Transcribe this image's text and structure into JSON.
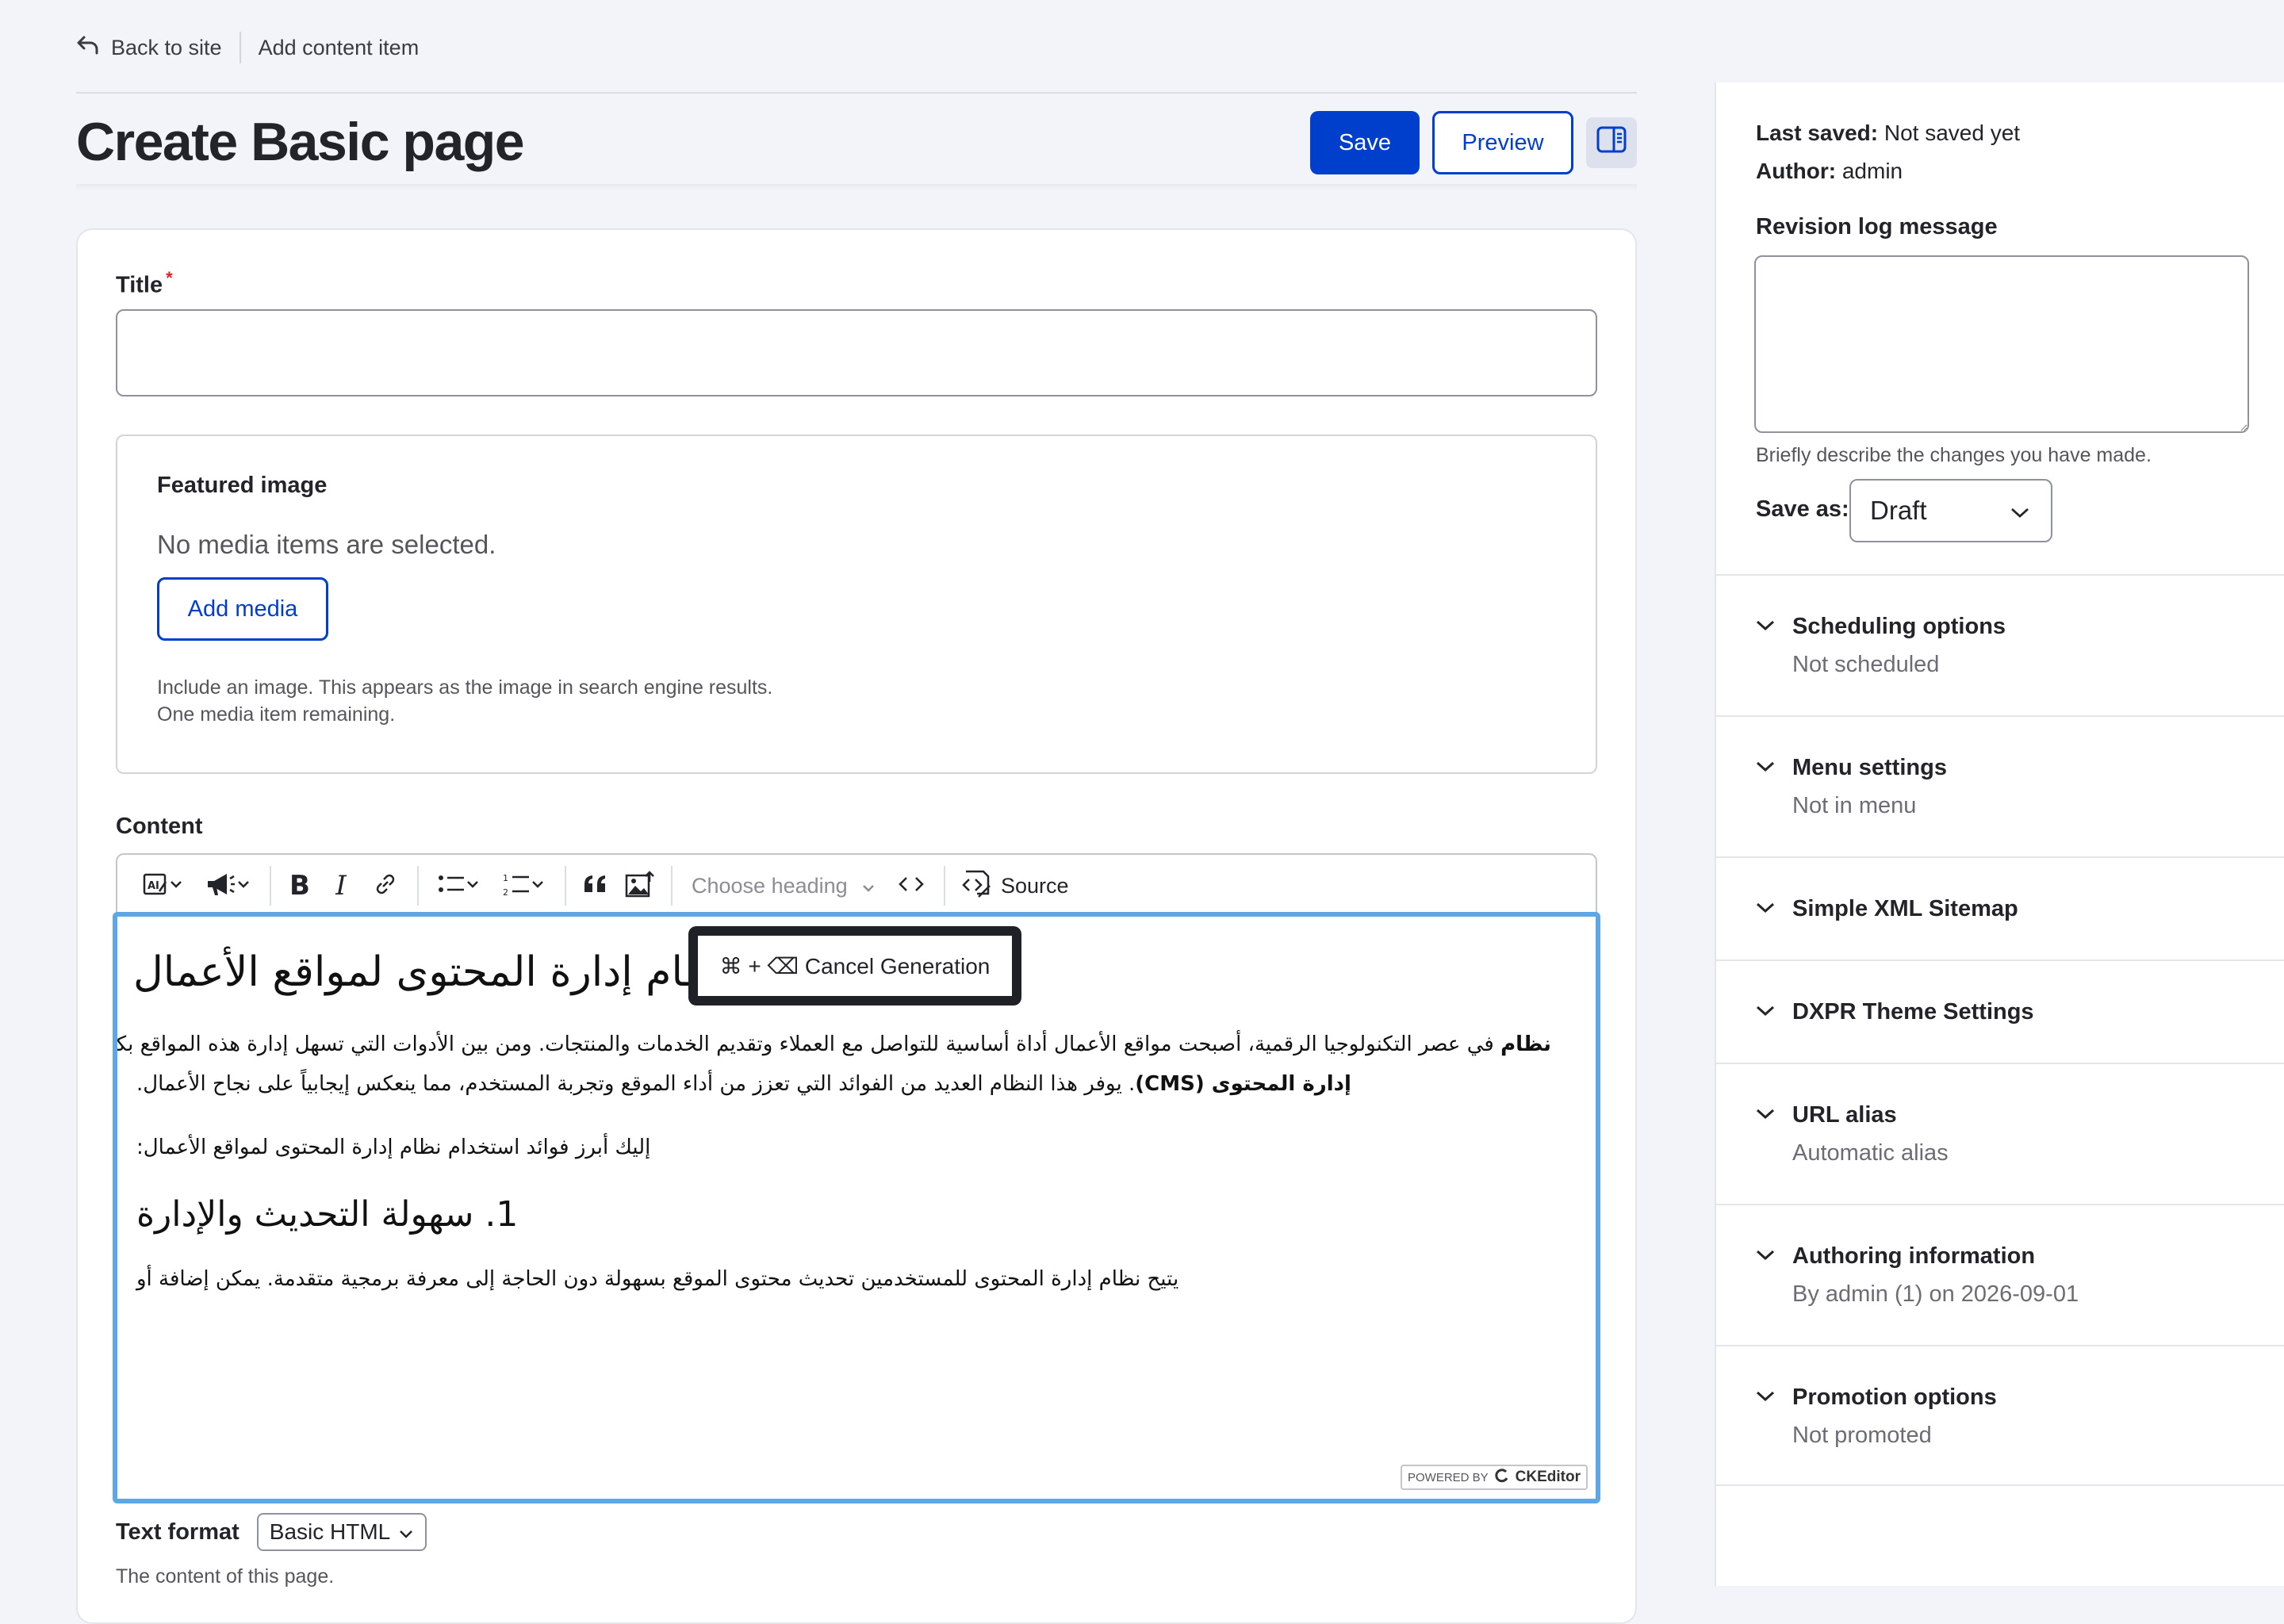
{
  "topbar": {
    "back_label": "Back to site",
    "breadcrumb": "Add content item"
  },
  "header": {
    "title": "Create Basic page",
    "save_label": "Save",
    "preview_label": "Preview"
  },
  "form": {
    "title_label": "Title",
    "title_required_mark": "*",
    "title_value": "",
    "featured": {
      "legend": "Featured image",
      "empty_text": "No media items are selected.",
      "add_label": "Add media",
      "desc_line1": "Include an image. This appears as the image in search engine results.",
      "desc_line2": "One media item remaining."
    },
    "content_label": "Content",
    "toolbar": {
      "heading_placeholder": "Choose heading",
      "source_label": "Source"
    },
    "editor": {
      "h1": "نظام إدارة المحتوى لمواقع الأعمال",
      "p1_line1": "في عصر التكنولوجيا الرقمية، أصبحت مواقع الأعمال أداة أساسية للتواصل مع العملاء وتقديم الخدمات والمنتجات. ومن بين الأدوات التي تسهل إدارة هذه المواقع بكفاءة هو",
      "p1_bold1": "نظام",
      "p1_bold2": "إدارة المحتوى (CMS)",
      "p1_line2": ". يوفر هذا النظام العديد من الفوائد التي تعزز من أداء الموقع وتجربة المستخدم، مما ينعكس إيجابياً على نجاح الأعمال.",
      "p2": "إليك أبرز فوائد استخدام نظام إدارة المحتوى لمواقع الأعمال:",
      "h2": "1. سهولة التحديث والإدارة",
      "p3": "يتيح نظام إدارة المحتوى للمستخدمين تحديث محتوى الموقع بسهولة دون الحاجة إلى معرفة برمجية متقدمة. يمكن إضافة أو"
    },
    "cancel_generation": "⌘ + ⌫ Cancel Generation",
    "ck_badge": {
      "powered_by": "POWERED BY",
      "brand": "CKEditor"
    },
    "text_format_label": "Text format",
    "text_format_value": "Basic HTML",
    "content_desc": "The content of this page."
  },
  "sidebar": {
    "last_saved_label": "Last saved:",
    "last_saved_value": "Not saved yet",
    "author_label": "Author:",
    "author_value": "admin",
    "revision_label": "Revision log message",
    "revision_value": "",
    "revision_desc": "Briefly describe the changes you have made.",
    "save_as_label": "Save as:",
    "save_as_value": "Draft",
    "accordions": [
      {
        "title": "Scheduling options",
        "summary": "Not scheduled"
      },
      {
        "title": "Menu settings",
        "summary": "Not in menu"
      },
      {
        "title": "Simple XML Sitemap",
        "summary": ""
      },
      {
        "title": "DXPR Theme Settings",
        "summary": ""
      },
      {
        "title": "URL alias",
        "summary": "Automatic alias"
      },
      {
        "title": "Authoring information",
        "summary": "By admin (1) on 2026-09-01"
      },
      {
        "title": "Promotion options",
        "summary": "Not promoted"
      }
    ]
  },
  "colors": {
    "primary": "#003ecc",
    "focus": "#5fa6e4",
    "required": "#dc2323"
  }
}
